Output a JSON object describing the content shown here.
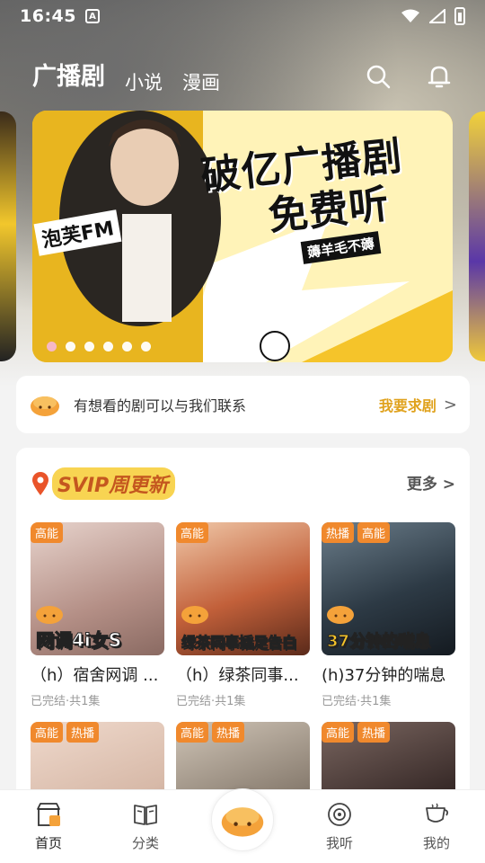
{
  "status_bar": {
    "time": "16:45",
    "indicator": "A"
  },
  "top_nav": {
    "tabs": [
      {
        "label": "广播剧",
        "active": true
      },
      {
        "label": "小说",
        "active": false
      },
      {
        "label": "漫画",
        "active": false
      }
    ],
    "icons": [
      "search-icon",
      "bell-icon"
    ]
  },
  "banner": {
    "headline_line1": "破亿广播剧",
    "headline_line2": "免费听",
    "subtitle": "薅羊毛不薅",
    "brand": "泡芙FM",
    "slide_count": 6,
    "active_slide": 1
  },
  "request_card": {
    "text": "有想看的剧可以与我们联系",
    "link_label": "我要求剧",
    "chevron": ">"
  },
  "svip_section": {
    "title": "SVIP周更新",
    "more_label": "更多",
    "items": [
      {
        "tags": [
          "高能"
        ],
        "cover_text": "网调4i女S",
        "title": "（h）宿舍网调 ...",
        "meta": "已完结·共1集",
        "cover_color": "#c8a9a0"
      },
      {
        "tags": [
          "高能"
        ],
        "cover_text": "绿茶同事插足告白",
        "title": "（h）绿茶同事...",
        "meta": "已完结·共1集",
        "cover_color": "#c2603a"
      },
      {
        "tags": [
          "热播",
          "高能"
        ],
        "cover_text": "37分钟的喘息",
        "title": "(h)37分钟的喘息",
        "meta": "已完结·共1集",
        "cover_color": "#2d3a45"
      },
      {
        "tags": [
          "高能",
          "热播"
        ],
        "cover_text": "",
        "title": "",
        "meta": "",
        "cover_color": "#d7b9a8"
      },
      {
        "tags": [
          "高能",
          "热播"
        ],
        "cover_text": "",
        "title": "",
        "meta": "",
        "cover_color": "#8b7f72"
      },
      {
        "tags": [
          "高能",
          "热播"
        ],
        "cover_text": "",
        "title": "",
        "meta": "",
        "cover_color": "#3a2c2a"
      }
    ]
  },
  "bottom_nav": [
    {
      "label": "首页",
      "icon": "home-shop-icon",
      "active": true
    },
    {
      "label": "分类",
      "icon": "book-icon",
      "active": false
    },
    {
      "label": "",
      "icon": "bun-logo-icon",
      "active": false
    },
    {
      "label": "我听",
      "icon": "disc-icon",
      "active": false
    },
    {
      "label": "我的",
      "icon": "cup-icon",
      "active": false
    }
  ],
  "colors": {
    "accent": "#f0892d",
    "gold": "#e0a21d",
    "svip_bg": "#f8d452"
  }
}
